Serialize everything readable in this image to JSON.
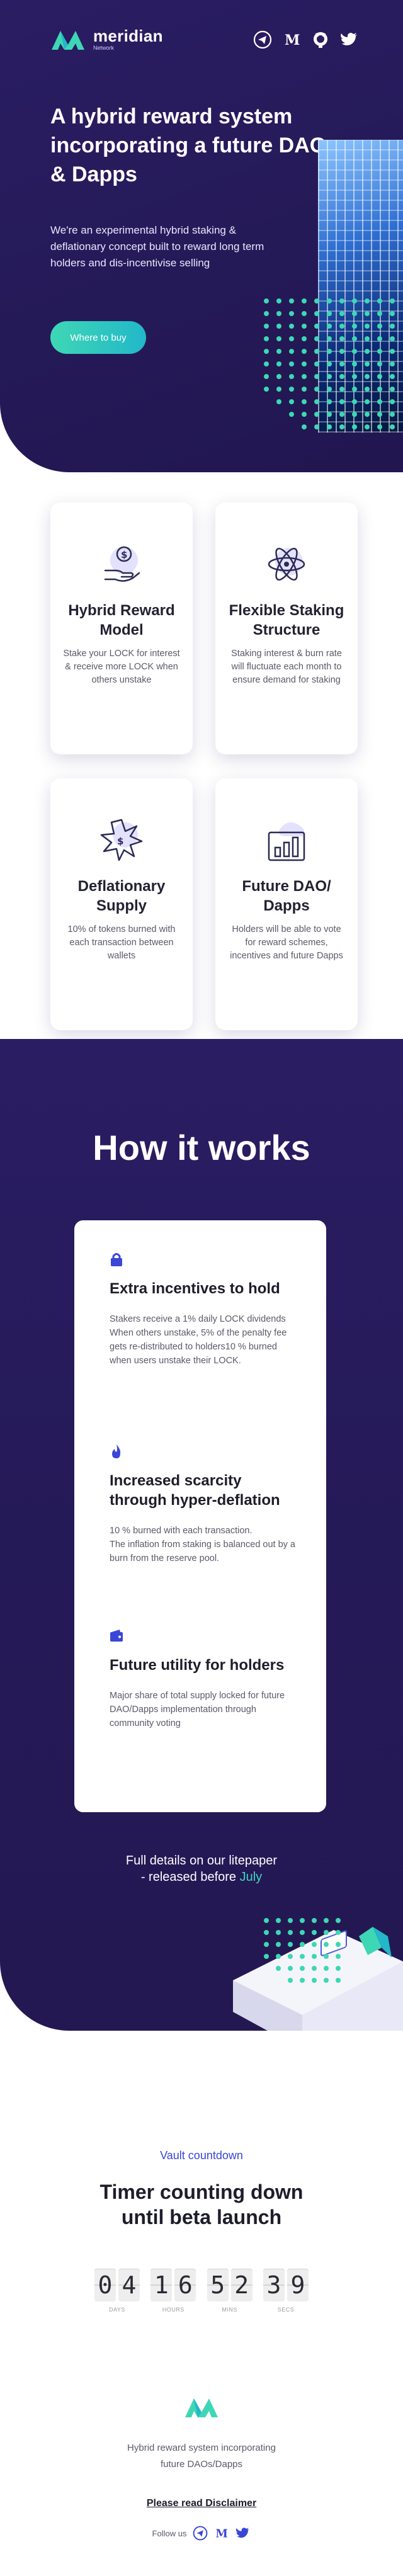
{
  "brand": {
    "name": "meridian",
    "sub": "Network",
    "teal": "#3ed7b5",
    "navy": "#2a1d63"
  },
  "header": {
    "social_icons": [
      "telegram-icon",
      "medium-icon",
      "github-icon",
      "twitter-icon"
    ]
  },
  "hero": {
    "title": "A hybrid reward system incorporating a future DAO & Dapps",
    "lead": "We're an experimental hybrid staking & deflationary concept built to reward long term holders and dis-incentivise selling",
    "cta": "Where to buy"
  },
  "features": [
    {
      "icon": "dollar-hand-icon",
      "title": "Hybrid Reward Model",
      "text": "Stake your LOCK for interest & receive more LOCK when others unstake"
    },
    {
      "icon": "atom-icon",
      "title": "Flexible Staking Structure",
      "text": "Staking interest & burn rate will fluctuate each month to ensure demand for staking"
    },
    {
      "icon": "starburst-icon",
      "title": "Deflationary Supply",
      "text": "10% of tokens burned with each transaction between wallets"
    },
    {
      "icon": "bar-chart-icon",
      "title": "Future DAO/ Dapps",
      "text": "Holders will be able to vote for reward schemes, incentives and future Dapps"
    }
  ],
  "how": {
    "title": "How it works",
    "items": [
      {
        "icon": "lock-icon",
        "title": "Extra incentives to hold",
        "text": "Stakers receive a 1% daily LOCK dividends\nWhen others unstake, 5% of the penalty fee gets re-distributed to holders10 % burned when users unstake their LOCK."
      },
      {
        "icon": "flame-icon",
        "title": "Increased scarcity through hyper-deflation",
        "text": "10 % burned with each transaction.\nThe inflation from staking is balanced out by a burn from the reserve pool."
      },
      {
        "icon": "wallet-icon",
        "title": "Future utility for holders",
        "text": "Major share of total supply locked for future DAO/Dapps implementation through community voting"
      }
    ],
    "details_line1": "Full details on our litepaper",
    "details_line2_prefix": "- released before ",
    "details_highlight": "July"
  },
  "countdown": {
    "kicker": "Vault countdown",
    "title": "Timer counting down\nuntil beta launch",
    "units": [
      {
        "label": "DAYS",
        "digits": [
          "0",
          "4"
        ]
      },
      {
        "label": "HOURS",
        "digits": [
          "1",
          "6"
        ]
      },
      {
        "label": "MINS",
        "digits": [
          "5",
          "2"
        ]
      },
      {
        "label": "SECS",
        "digits": [
          "3",
          "9"
        ]
      }
    ]
  },
  "footer": {
    "tagline": "Hybrid reward system incorporating\nfuture DAOs/Dapps",
    "disclaimer": "Please read Disclaimer",
    "follow": "Follow us",
    "social_icons": [
      "telegram-icon",
      "medium-icon",
      "twitter-icon"
    ]
  }
}
